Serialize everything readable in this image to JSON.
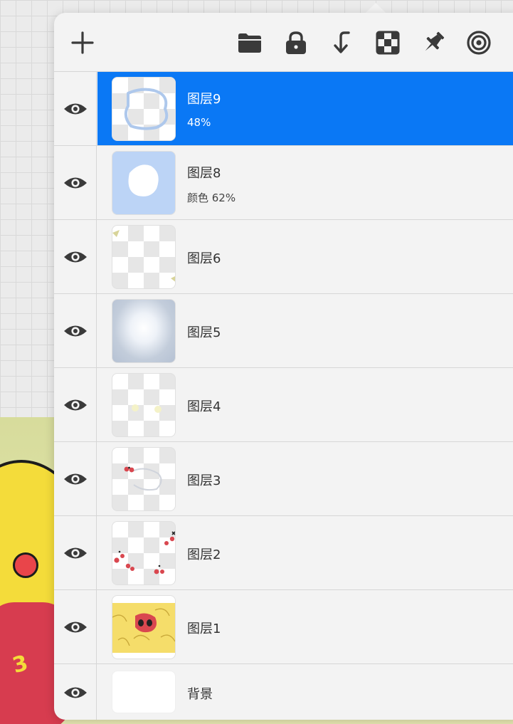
{
  "toolbar": {
    "icons": [
      "add-icon",
      "folder-icon",
      "lock-icon",
      "merge-down-icon",
      "checkerboard-icon",
      "pin-icon",
      "target-icon"
    ]
  },
  "layers": [
    {
      "name": "图层9",
      "sub": "48%",
      "selected": true
    },
    {
      "name": "图层8",
      "sub": "颜色    62%",
      "selected": false
    },
    {
      "name": "图层6",
      "sub": "",
      "selected": false
    },
    {
      "name": "图层5",
      "sub": "",
      "selected": false
    },
    {
      "name": "图层4",
      "sub": "",
      "selected": false
    },
    {
      "name": "图层3",
      "sub": "",
      "selected": false
    },
    {
      "name": "图层2",
      "sub": "",
      "selected": false
    },
    {
      "name": "图层1",
      "sub": "",
      "selected": false
    },
    {
      "name": "背景",
      "sub": "",
      "selected": false
    }
  ],
  "colors": {
    "selected": "#0a78f5",
    "panel": "#f3f3f3",
    "icon": "#3a3a3a"
  },
  "canvas_art": {
    "mark": "3"
  }
}
